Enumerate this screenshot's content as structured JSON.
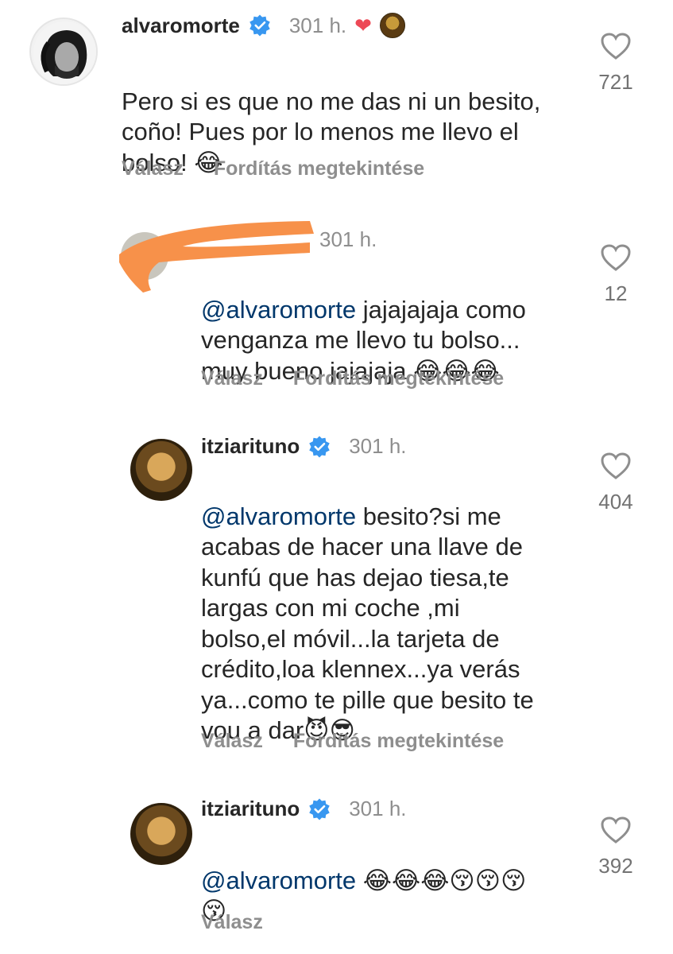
{
  "comments": [
    {
      "username": "alvaromorte",
      "time": "301 h.",
      "text": "Pero si es que no me das ni un besito,\ncoño! Pues por lo menos me llevo el\nbolso! 😂",
      "likes": "721",
      "reply_label": "Válasz",
      "translate_label": "Fordítás megtekintése"
    },
    {
      "username": "",
      "time": "301 h.",
      "mention": "@alvaromorte",
      "text": " jajajajaja como\nvenganza me llevo tu bolso...\nmuy bueno jajajaja 😂😂😂",
      "likes": "12",
      "reply_label": "Válasz",
      "translate_label": "Fordítás megtekintése"
    },
    {
      "username": "itziarituno",
      "time": "301 h.",
      "mention": "@alvaromorte",
      "text": " besito?si me\nacabas de hacer una llave de\nkunfú que has dejao tiesa,te\nlargas con mi coche ,mi\nbolso,el móvil...la tarjeta de\ncrédito,loa klennex...ya verás\nya...como te pille que besito te\nvou a dar😈😎",
      "likes": "404",
      "reply_label": "Válasz",
      "translate_label": "Fordítás megtekintése"
    },
    {
      "username": "itziarituno",
      "time": "301 h.",
      "mention": "@alvaromorte",
      "text": " 😂😂😂😚😚😚\n😚",
      "likes": "392",
      "reply_label": "Válasz"
    }
  ],
  "colors": {
    "verified": "#3897f0",
    "mention": "#00376b",
    "secondary": "#8e8e8e",
    "heart": "#ed4956",
    "redaction": "#f7914a"
  },
  "icons": {
    "like": "heart-outline-icon",
    "verified": "verified-badge-icon"
  }
}
